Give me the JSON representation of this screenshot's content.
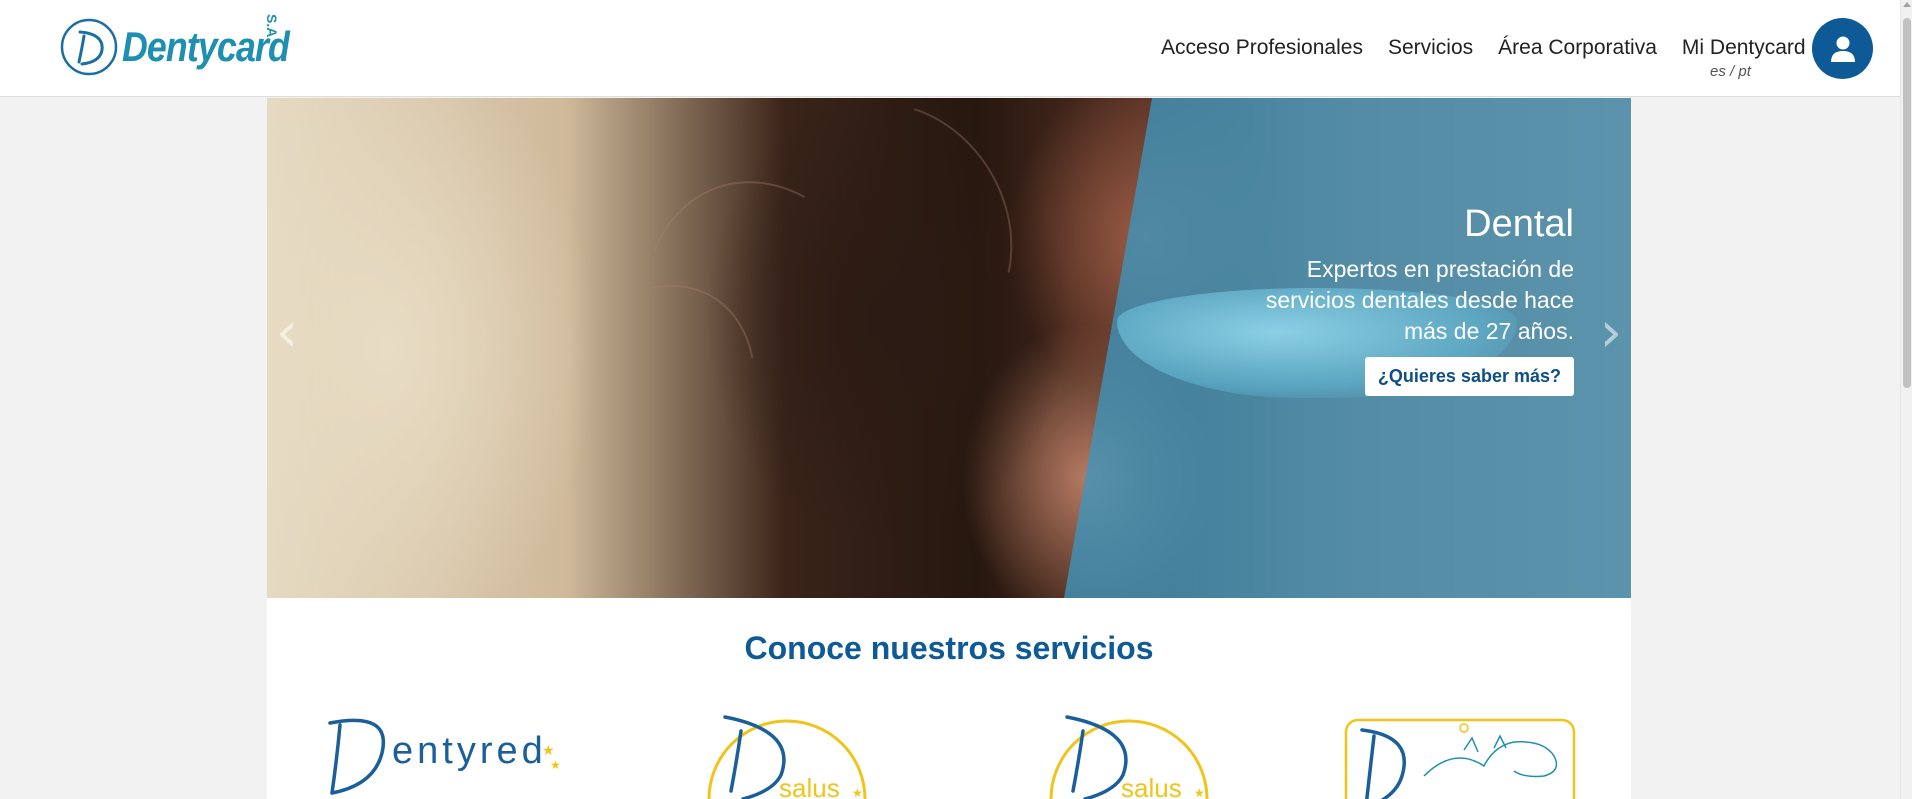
{
  "brand": {
    "logo_text": "Dentycard",
    "logo_suffix": "S.A."
  },
  "nav": {
    "items": [
      "Acceso Profesionales",
      "Servicios",
      "Área Corporativa",
      "Mi Dentycard"
    ],
    "lang_es": "es",
    "lang_sep": " / ",
    "lang_pt": "pt"
  },
  "hero": {
    "title": "Dental",
    "text": "Expertos en prestación de servicios dentales desde hace más de 27 años.",
    "button": "¿Quieres saber más?",
    "prev_icon": "chevron-left-icon",
    "next_icon": "chevron-right-icon"
  },
  "services": {
    "title": "Conoce nuestros servicios",
    "logos": [
      {
        "name": "dentyred-logo",
        "text": "entyred"
      },
      {
        "name": "dsalus-logo",
        "text": "salus"
      },
      {
        "name": "dsalus-logo-2",
        "text": "salus"
      },
      {
        "name": "pet-logo",
        "text": ""
      }
    ]
  },
  "colors": {
    "brand_blue": "#0d5a96",
    "logo_teal": "#1e8fb0",
    "accent_yellow": "#f0c419",
    "overlay": "#3c96be"
  }
}
